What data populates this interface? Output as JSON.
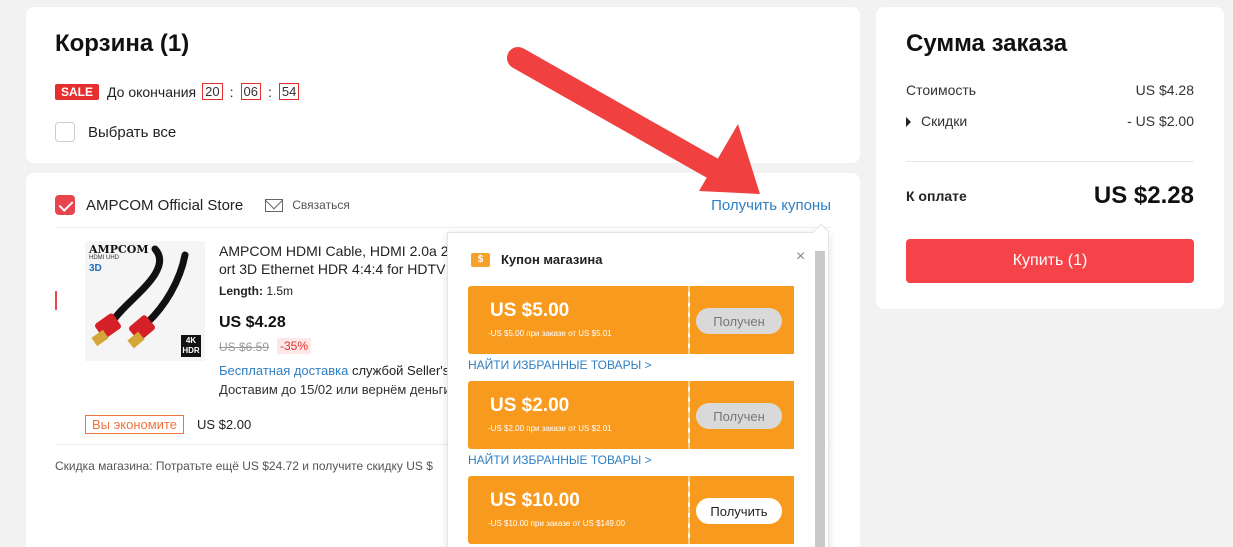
{
  "cart": {
    "title": "Корзина (1)",
    "sale_badge": "SALE",
    "sale_label": "До окончания",
    "timer": [
      "20",
      "06",
      "54"
    ],
    "timer_sep": ":",
    "select_all": "Выбрать все"
  },
  "store": {
    "name": "AMPCOM Official Store",
    "contact": "Связаться",
    "get_coupons": "Получить купоны",
    "product": {
      "brand": "AMPCOM",
      "brand_sub": "HDMI UHD",
      "badge_3d": "3D",
      "badge_4k": "4K",
      "badge_hdr": "HDR",
      "title_line1": "AMPCOM HDMI Cable, HDMI 2.0a 2",
      "title_line2": "ort 3D Ethernet HDR 4:4:4 for HDTV",
      "length_label": "Length:",
      "length_value": "1.5m",
      "price": "US $4.28",
      "old_price": "US $6.59",
      "discount": "-35%",
      "free_shipping": "Бесплатная доставка",
      "shipping_by": "службой Seller's",
      "delivery": "Доставим до 15/02 или вернём деньги"
    },
    "savings_tag": "Вы экономите",
    "savings_value": "US $2.00",
    "store_discount": "Скидка магазина:  Потратьте ещё US $24.72 и получите скидку US $"
  },
  "summary": {
    "title": "Сумма заказа",
    "cost_label": "Стоимость",
    "cost_value": "US $4.28",
    "discount_label": "Скидки",
    "discount_value": "- US $2.00",
    "total_label": "К оплате",
    "total_value": "US $2.28",
    "buy_button": "Купить (1)"
  },
  "coupon_popup": {
    "header": "Купон магазина",
    "icon_symbol": "$",
    "close": "×",
    "find_link": "НАЙТИ ИЗБРАННЫЕ ТОВАРЫ >",
    "coupons": [
      {
        "amount": "US $5.00",
        "condition": "-US $5.00 при заказе от US $5.01",
        "button": "Получен",
        "state": "taken"
      },
      {
        "amount": "US $2.00",
        "condition": "-US $2.00 при заказе от US $2.01",
        "button": "Получен",
        "state": "taken"
      },
      {
        "amount": "US $10.00",
        "condition": "-US $10.00 при заказе от US $149.00",
        "button": "Получить",
        "state": "active"
      }
    ]
  },
  "colors": {
    "accent_red": "#f6434a",
    "coupon_orange": "#f89a1e",
    "link_blue": "#2f7fc2",
    "arrow_red": "#f04040"
  }
}
